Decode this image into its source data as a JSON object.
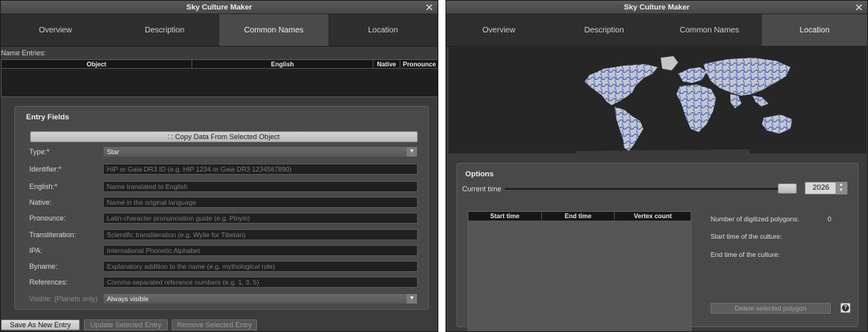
{
  "left_window": {
    "title": "Sky Culture Maker",
    "close_icon": "✕",
    "tabs": [
      "Overview",
      "Description",
      "Common Names",
      "Location"
    ],
    "active_tab": "Common Names",
    "name_entries_label": "Name Entries:",
    "table_columns": [
      "Object",
      "English",
      "Native",
      "Pronounce"
    ],
    "entry_fields_title": "Entry Fields",
    "copy_button": "Copy Data From Selected Object",
    "copy_button_icon": "expand-arrows-icon",
    "fields": [
      {
        "label": "Type:*",
        "kind": "select",
        "value": "Star"
      },
      {
        "label": "Identifier:*",
        "kind": "input",
        "placeholder": "HIP or Gaia DR3 ID (e.g. HIP 1234 or Gaia DR3 1234567890)"
      },
      {
        "label": "English:*",
        "kind": "input",
        "placeholder": "Name translated to English"
      },
      {
        "label": "Native:",
        "kind": "input",
        "placeholder": "Name in the original language"
      },
      {
        "label": "Pronounce:",
        "kind": "input",
        "placeholder": "Latin-character pronunciation guide (e.g. Pinyin)"
      },
      {
        "label": "Transliteration:",
        "kind": "input",
        "placeholder": "Scientific transliteration (e.g. Wylie for Tibetan)"
      },
      {
        "label": "IPA:",
        "kind": "input",
        "placeholder": "International Phonetic Alphabet"
      },
      {
        "label": "Byname:",
        "kind": "input",
        "placeholder": "Explanatory addition to the name (e.g. mythological role)"
      },
      {
        "label": "References:",
        "kind": "input",
        "placeholder": "Comma-separated reference numbers (e.g. 1, 3, 5)"
      },
      {
        "label": "Visible: (Planets only)",
        "kind": "select",
        "value": "Always visible",
        "disabled": true
      }
    ],
    "buttons": {
      "save": "Save As New Entry",
      "update": "Update Selected Entry",
      "remove": "Remove Selected Entry"
    }
  },
  "right_window": {
    "title": "Sky Culture Maker",
    "close_icon": "✕",
    "tabs": [
      "Overview",
      "Description",
      "Common Names",
      "Location"
    ],
    "active_tab": "Location",
    "map_icon": "world-map",
    "options_title": "Options",
    "current_time_label": "Current time",
    "current_time_value": "2026",
    "slider_level": 0.97,
    "table_columns": [
      "Start time",
      "End time",
      "Vertex count"
    ],
    "polygons_label": "Number of digitized polygons:",
    "polygons_count": "0",
    "start_time_label": "Start time of the culture:",
    "end_time_label": "End time of the culture:",
    "delete_button": "Delete selected polygon",
    "help_icon": "?"
  },
  "colors": {
    "window_bg": "#3b3b3b",
    "tab_bar": "#2e2e2e",
    "active_tab": "#4a4a4a",
    "input_bg": "#202020",
    "map_land": "#c8c8c8",
    "map_rivers": "#2f5bd6"
  }
}
